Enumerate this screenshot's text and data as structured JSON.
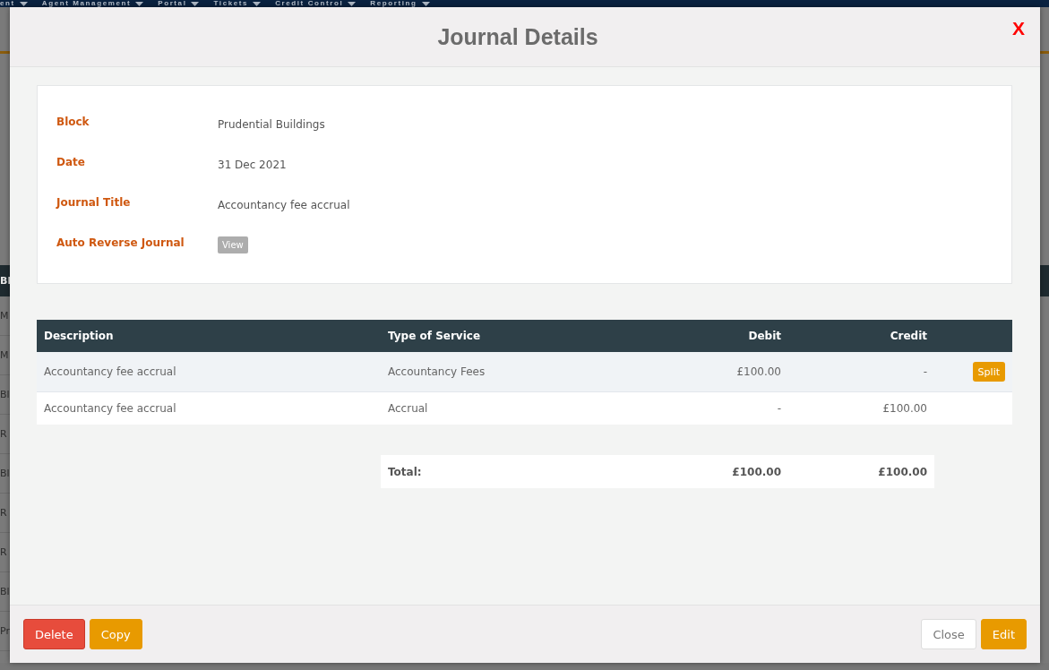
{
  "background_page": {
    "nav_items": [
      {
        "label": "ent"
      },
      {
        "label": "Agent Management"
      },
      {
        "label": "Portal"
      },
      {
        "label": "Tickets"
      },
      {
        "label": "Credit Control"
      },
      {
        "label": "Reporting"
      }
    ],
    "table_header": "Bl",
    "table_rows": [
      "M",
      "M",
      "Bl",
      "R",
      "Bl",
      "R",
      "R",
      "Bl",
      "Pr"
    ]
  },
  "dialog": {
    "title": "Journal Details",
    "close": "X"
  },
  "details": [
    {
      "label": "Block",
      "kind": "text",
      "value": "Prudential Buildings"
    },
    {
      "label": "Date",
      "kind": "text",
      "value": "31 Dec 2021"
    },
    {
      "label": "Journal Title",
      "kind": "text",
      "value": "Accountancy fee accrual"
    },
    {
      "label": "Auto Reverse Journal",
      "kind": "button",
      "value": "View",
      "disabled": true
    }
  ],
  "table": {
    "columns": [
      "Description",
      "Type of Service",
      "Debit",
      "Credit"
    ],
    "rows": [
      {
        "cells": [
          "Accountancy fee accrual",
          "Accountancy Fees",
          "£100.00",
          "-"
        ],
        "action": "Split"
      },
      {
        "cells": [
          "Accountancy fee accrual",
          "Accrual",
          "-",
          "£100.00"
        ]
      }
    ],
    "total": {
      "label": "Total:",
      "debit": "£100.00",
      "credit": "£100.00"
    }
  },
  "footer": {
    "left_buttons": [
      {
        "label": "Delete",
        "kind": "danger"
      },
      {
        "label": "Copy",
        "kind": "warning"
      }
    ],
    "right_buttons": [
      {
        "label": "Close",
        "kind": "default"
      },
      {
        "label": "Edit",
        "kind": "warning"
      }
    ]
  }
}
